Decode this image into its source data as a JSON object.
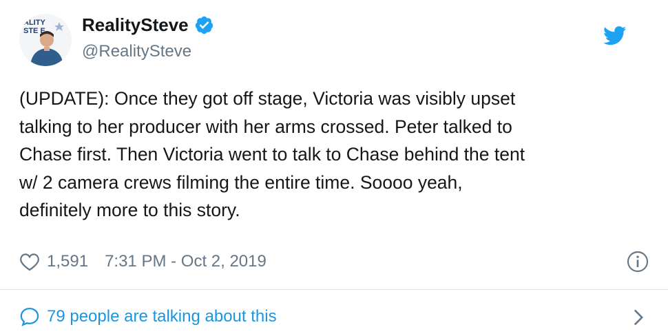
{
  "user": {
    "display_name": "RealitySteve",
    "handle": "@RealitySteve",
    "avatar_text": "REALITY STEVE",
    "verified": true
  },
  "tweet": {
    "text": "(UPDATE): Once they got off stage, Victoria was visibly upset\ntalking to her producer with her arms crossed. Peter talked to\nChase first. Then Victoria went to talk to Chase behind the tent\nw/ 2 camera crews filming the entire time.  Soooo yeah,\ndefinitely more to this story.",
    "likes": "1,591",
    "timestamp": "7:31 PM - Oct 2, 2019"
  },
  "footer": {
    "talking_label": "79 people are talking about this"
  },
  "icons": {
    "brand": "twitter-bird-icon",
    "verified": "verified-badge-icon",
    "like": "heart-icon",
    "info": "info-icon",
    "reply": "speech-bubble-icon",
    "chevron": "chevron-right-icon"
  },
  "colors": {
    "brand_blue": "#1da1f2",
    "link_blue": "#1b95e0",
    "text": "#14171a",
    "muted": "#657786",
    "divider": "#e1e8ed"
  }
}
